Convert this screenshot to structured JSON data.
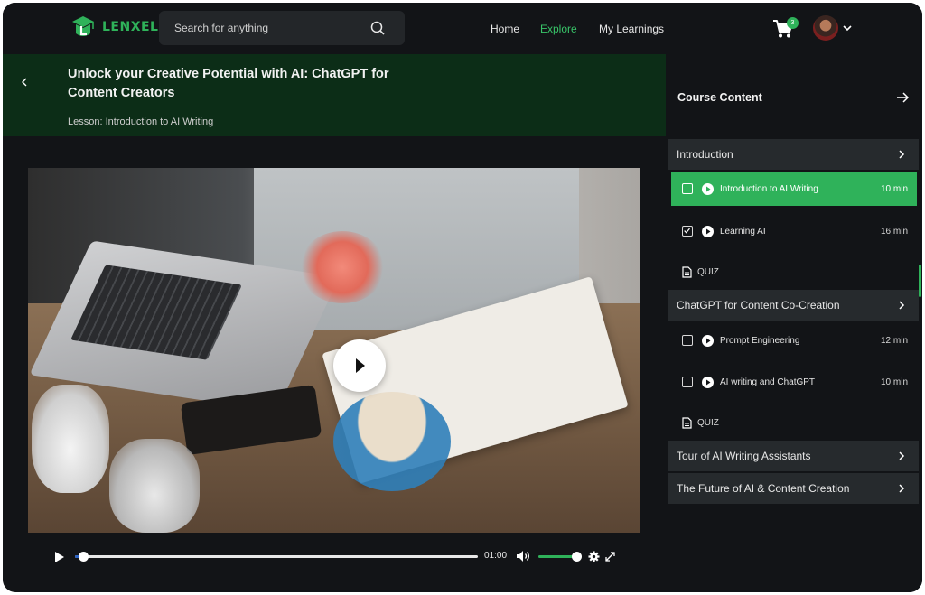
{
  "header": {
    "brand": "LENXEL",
    "search": {
      "placeholder": "Search for anything"
    },
    "nav": [
      {
        "label": "Home",
        "active": false
      },
      {
        "label": "Explore",
        "active": true
      },
      {
        "label": "My Learnings",
        "active": false
      }
    ],
    "cart_count": "3",
    "accent_color": "#2fb25a"
  },
  "lesson_header": {
    "title": "Unlock your Creative Potential with AI: ChatGPT for Content Creators",
    "subtitle": "Lesson: Introduction to AI Writing"
  },
  "player": {
    "current_time": "01:00",
    "progress": 0.02,
    "volume": 1.0
  },
  "sidebar": {
    "title": "Course Content",
    "sections": [
      {
        "label": "Introduction"
      },
      {
        "label": "ChatGPT for Content Co-Creation"
      },
      {
        "label": "Tour of AI Writing Assistants"
      },
      {
        "label": "The Future of AI & Content Creation"
      }
    ],
    "lessons": [
      {
        "label": "Introduction to AI Writing",
        "duration": "10 min",
        "checked": false,
        "active": true
      },
      {
        "label": "Learning AI",
        "duration": "16 min",
        "checked": true,
        "active": false
      },
      {
        "label": "Prompt Engineering",
        "duration": "12 min",
        "checked": false,
        "active": false
      },
      {
        "label": "AI writing and ChatGPT",
        "duration": "10 min",
        "checked": false,
        "active": false
      }
    ],
    "quiz_label": "QUIZ"
  }
}
